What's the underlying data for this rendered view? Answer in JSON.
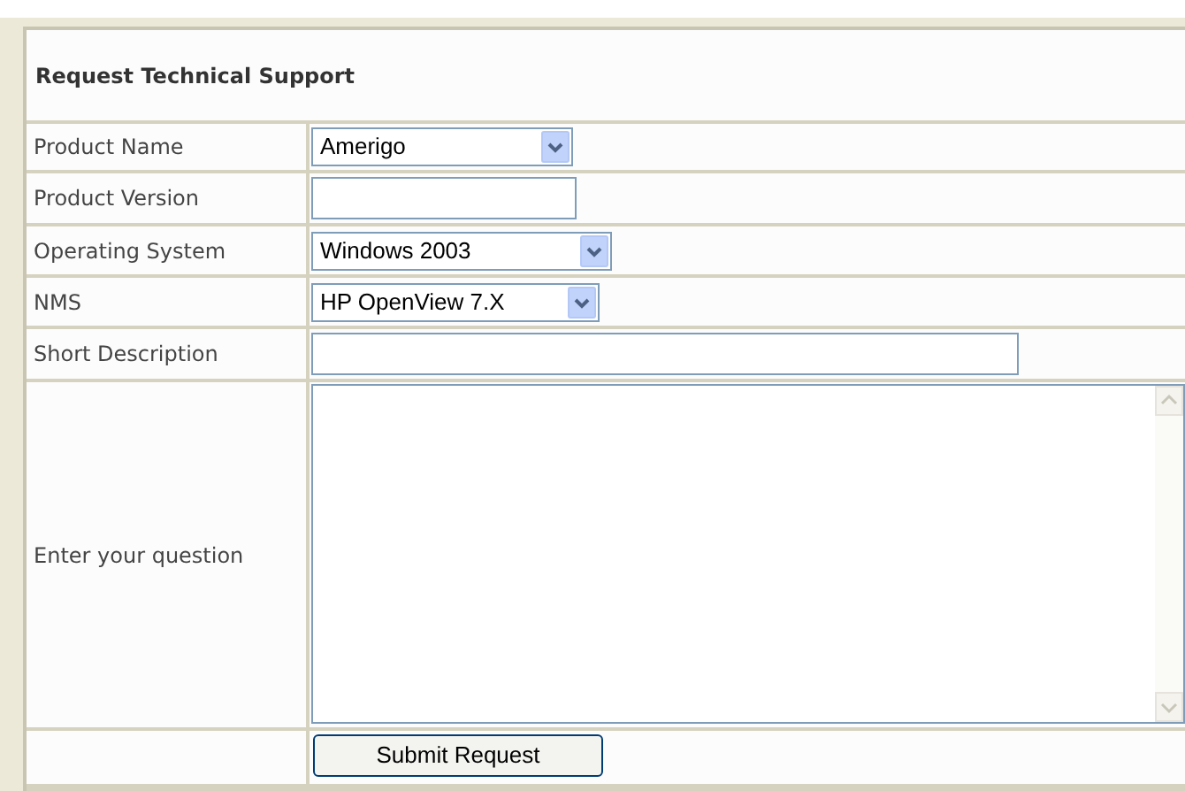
{
  "form": {
    "title": "Request Technical Support",
    "rows": [
      {
        "label": "Product Name",
        "kind": "select",
        "value": "Amerigo"
      },
      {
        "label": "Product Version",
        "kind": "text"
      },
      {
        "label": "Operating System",
        "kind": "select",
        "value": "Windows 2003"
      },
      {
        "label": "NMS",
        "kind": "select",
        "value": "HP OpenView 7.X"
      },
      {
        "label": "Short Description",
        "kind": "text"
      },
      {
        "label": "Enter your question",
        "kind": "textarea"
      },
      {
        "kind": "button",
        "value": "Submit Request"
      }
    ]
  }
}
